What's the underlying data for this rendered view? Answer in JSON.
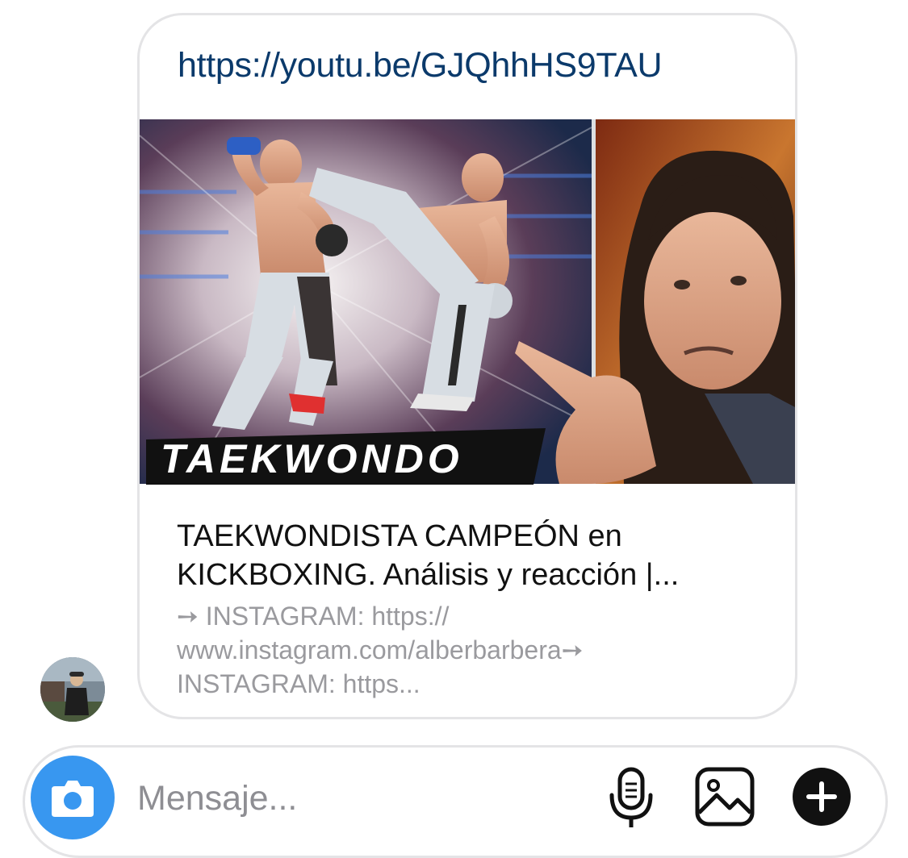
{
  "message": {
    "link_url": "https://youtu.be/GJQhhHS9TAU",
    "thumbnail_overlay_text": "TAEKWONDO",
    "preview_title": "TAEKWONDISTA CAMPEÓN en KICKBOXING. Análisis y reacción |...",
    "preview_description": "➙ INSTAGRAM: https:// www.instagram.com/alberbarbera➙ INSTAGRAM: https..."
  },
  "composer": {
    "placeholder": "Mensaje...",
    "camera_icon": "camera-icon",
    "mic_icon": "microphone-icon",
    "gallery_icon": "image-gallery-icon",
    "plus_icon": "plus-circle-icon",
    "accent_color": "#3897f0"
  }
}
